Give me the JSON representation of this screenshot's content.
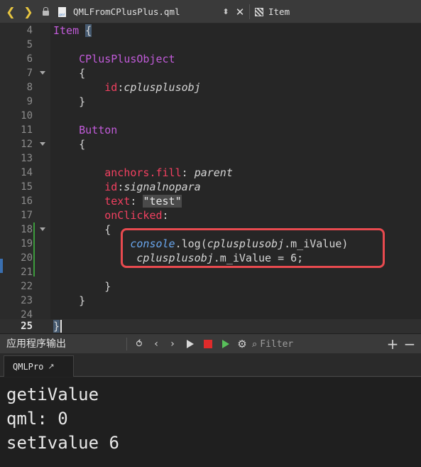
{
  "toolbar": {
    "back_icon": "chevron-left-icon",
    "forward_icon": "chevron-right-icon",
    "file_name": "QMLFromCPlusPlus.qml",
    "symbol_name": "Item"
  },
  "editor": {
    "lines": [
      {
        "num": "4"
      },
      {
        "num": "5"
      },
      {
        "num": "6"
      },
      {
        "num": "7"
      },
      {
        "num": "8"
      },
      {
        "num": "9"
      },
      {
        "num": "10"
      },
      {
        "num": "11"
      },
      {
        "num": "12"
      },
      {
        "num": "13"
      },
      {
        "num": "14"
      },
      {
        "num": "15"
      },
      {
        "num": "16"
      },
      {
        "num": "17"
      },
      {
        "num": "18"
      },
      {
        "num": "19"
      },
      {
        "num": "20"
      },
      {
        "num": "21"
      },
      {
        "num": "22"
      },
      {
        "num": "23"
      },
      {
        "num": "24"
      },
      {
        "num": "25"
      }
    ],
    "tokens": {
      "item": "Item",
      "open_brace": "{",
      "close_brace": "}",
      "cplusplus_object": "CPlusPlusObject",
      "id_prop": "id",
      "colon": ":",
      "cplusplusobj": "cplusplusobj",
      "button": "Button",
      "anchors_fill": "anchors.fill",
      "parent": "parent",
      "signalnopara": "signalnopara",
      "text_prop": "text",
      "test_str": "\"test\"",
      "on_clicked": "onClicked",
      "console": "console",
      "log_call": ".log(",
      "m_ivalue_access": ".m_iValue)",
      "assign_rest": ".m_iValue = 6;"
    }
  },
  "output": {
    "title": "应用程序输出",
    "filter_placeholder": "Filter",
    "tab_label": "QMLPro",
    "lines": [
      "getiValue",
      "qml: 0",
      "setIvalue 6"
    ]
  }
}
